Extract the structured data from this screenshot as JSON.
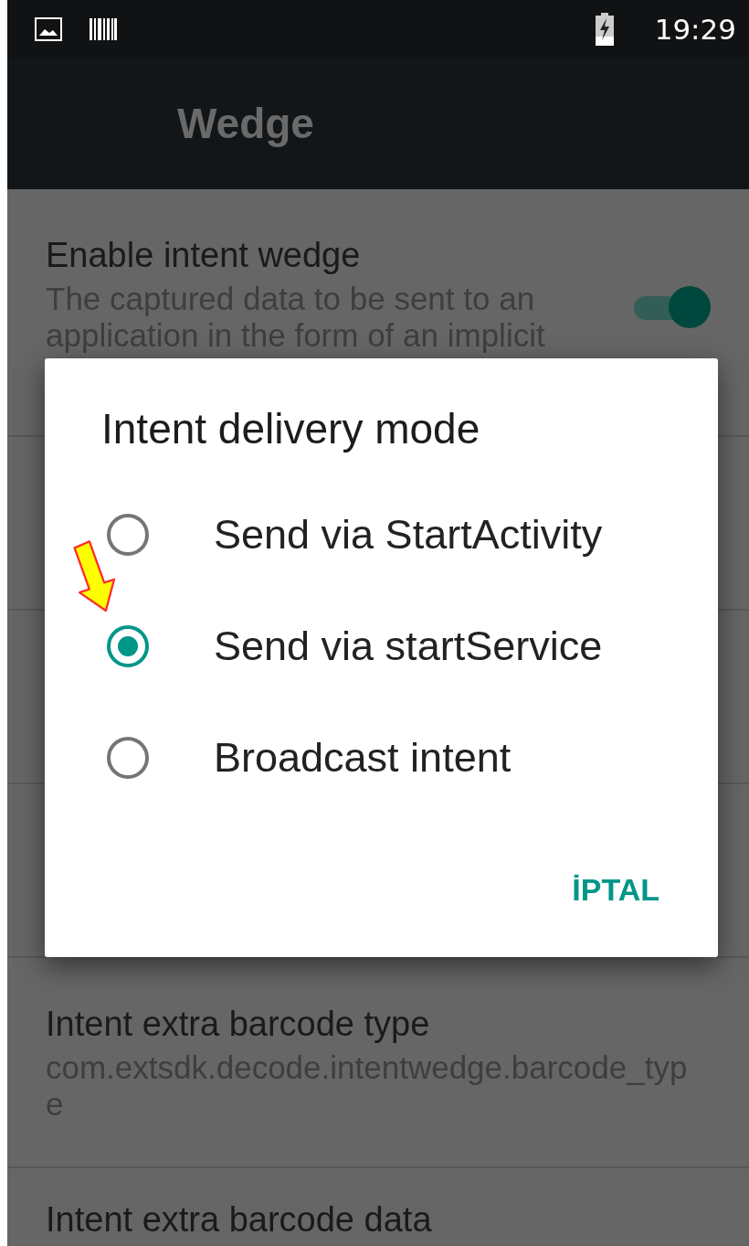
{
  "status_bar": {
    "time": "19:29"
  },
  "toolbar": {
    "title": "Wedge"
  },
  "settings": [
    {
      "kind": "switch",
      "title": "Enable intent wedge",
      "summary": "The captured data to be sent to an application in the form of an implicit",
      "on": true
    },
    {
      "kind": "text",
      "title": "Intent extra barcode type",
      "summary": "com.extsdk.decode.intentwedge.barcode_type"
    },
    {
      "kind": "text",
      "title": "Intent extra barcode data"
    }
  ],
  "dialog": {
    "title": "Intent delivery mode",
    "options": [
      {
        "label": "Send via StartActivity",
        "selected": false
      },
      {
        "label": "Send via startService",
        "selected": true
      },
      {
        "label": "Broadcast intent",
        "selected": false
      }
    ],
    "buttons": [
      "İPTAL"
    ]
  }
}
